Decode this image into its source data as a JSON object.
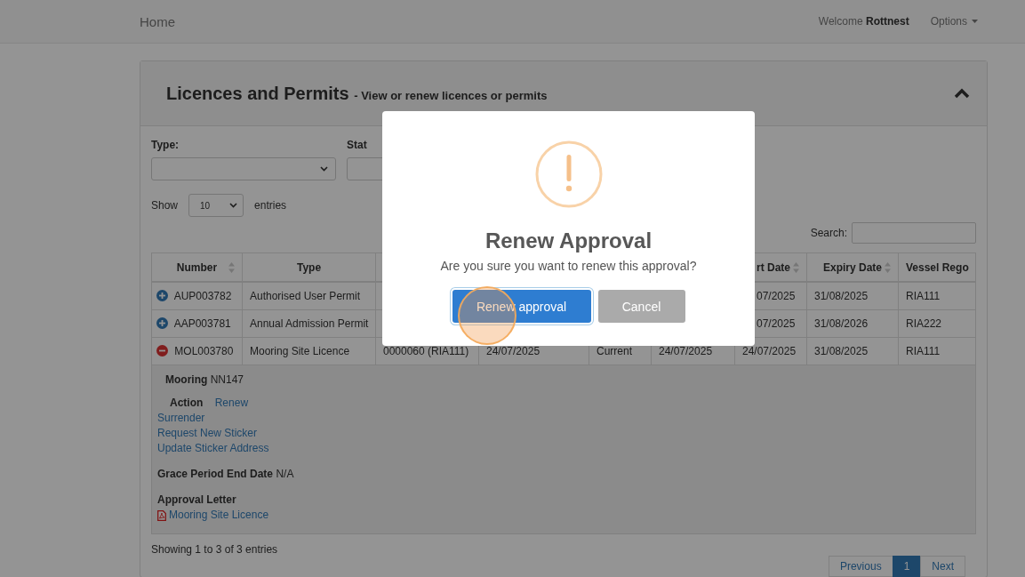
{
  "navbar": {
    "brand": "Home",
    "welcome_text": "Welcome",
    "user": "Rottnest",
    "options_menu": "Options"
  },
  "panel": {
    "title": "Licences and Permits",
    "subtitle": "- View or renew licences or permits",
    "expanded": true
  },
  "filters": [
    {
      "label": "Type:"
    },
    {
      "label": "Stat"
    }
  ],
  "length_menu": {
    "prefix": "Show",
    "value": "10",
    "suffix": "entries"
  },
  "search": {
    "label": "Search:"
  },
  "table": {
    "columns": [
      {
        "label": "Number",
        "sortable": true
      },
      {
        "label": "Type",
        "sortable": false
      },
      null,
      null,
      null,
      null,
      {
        "label": "rt Date",
        "sortable": true
      },
      {
        "label": "Expiry Date",
        "sortable": true
      },
      {
        "label": "Vessel Rego",
        "sortable": false
      }
    ],
    "rows": [
      {
        "expanded": false,
        "cells": [
          "AUP003782",
          "Authorised User Permit",
          null,
          null,
          null,
          null,
          "07/2025",
          "31/08/2025",
          "RIA111"
        ]
      },
      {
        "expanded": false,
        "cells": [
          "AAP003781",
          "Annual Admission Permit",
          null,
          null,
          null,
          null,
          "07/2025",
          "31/08/2026",
          "RIA222"
        ]
      },
      {
        "expanded": true,
        "cells": [
          "MOL003780",
          "Mooring Site Licence",
          "0000060 (RIA111)",
          "24/07/2025",
          "Current",
          "24/07/2025",
          "24/07/2025",
          "31/08/2025",
          "RIA111"
        ],
        "details": {
          "mooring_label": "Mooring",
          "mooring_value": "NN147",
          "action_label": "Action",
          "actions": [
            "Renew",
            "Surrender",
            "Request New Sticker",
            "Update Sticker Address"
          ],
          "grace_label": "Grace Period End Date",
          "grace_value": "N/A",
          "letter_label": "Approval Letter",
          "letter_link": "Mooring Site Licence"
        }
      }
    ]
  },
  "info": "Showing 1 to 3 of 3 entries",
  "pagination": [
    {
      "label": "Previous",
      "selected": false
    },
    {
      "label": "1",
      "selected": true
    },
    {
      "label": "Next",
      "selected": false
    }
  ],
  "modal": {
    "title": "Renew Approval",
    "message": "Are you sure you want to renew this approval?",
    "buttons": [
      {
        "label": "Renew approval",
        "kind": "confirm",
        "focused": true
      },
      {
        "label": "Cancel",
        "kind": "cancel",
        "focused": false
      }
    ]
  }
}
